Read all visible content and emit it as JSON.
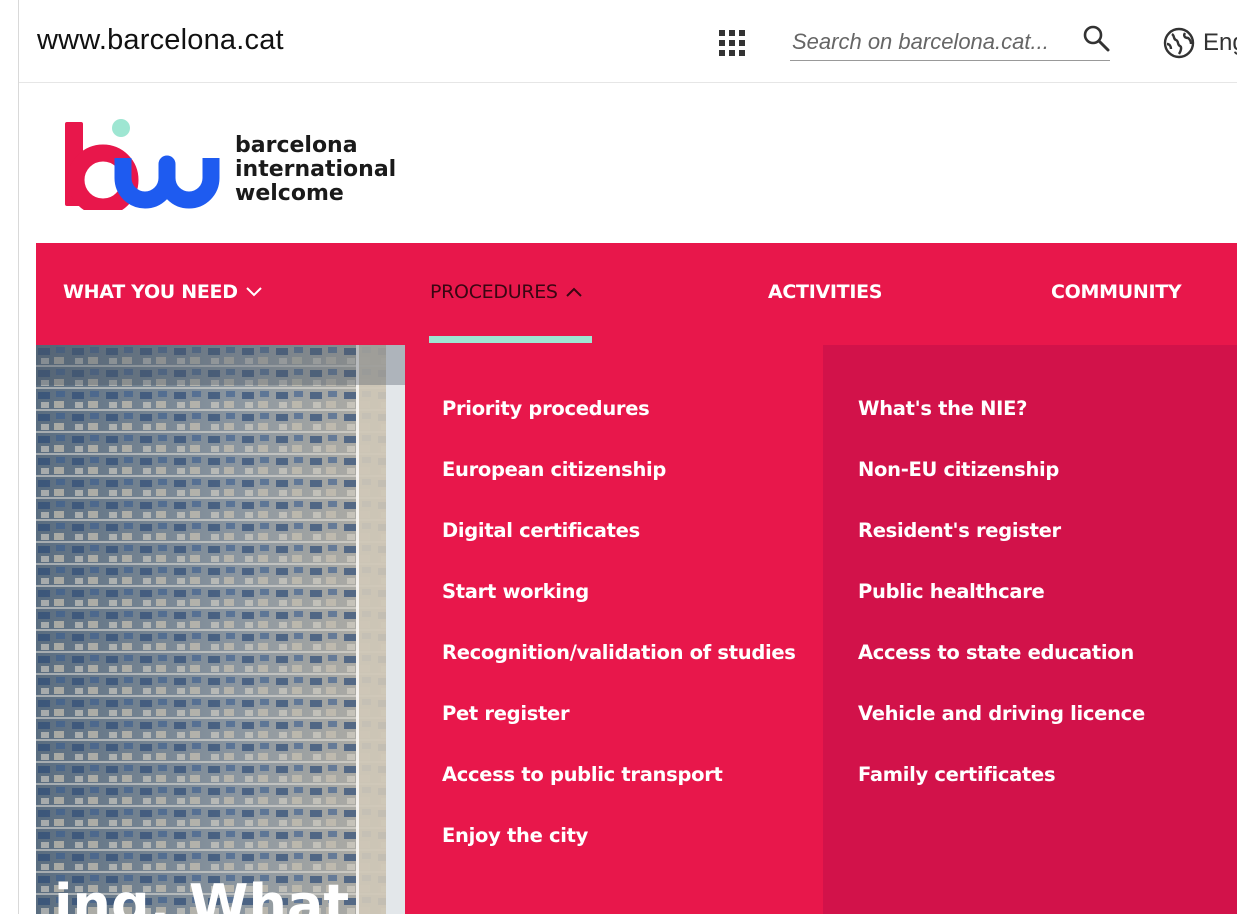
{
  "header": {
    "site_url": "www.barcelona.cat",
    "apps_icon": "grid-apps-icon",
    "search_placeholder": "Search on barcelona.cat...",
    "search_icon": "search-icon",
    "language_label": "Eng",
    "language_icon": "globe-icon"
  },
  "logo": {
    "lines": [
      "barcelona",
      "international",
      "welcome"
    ],
    "colors": {
      "red": "#e8174b",
      "blue": "#1e5bf0",
      "mint": "#9ee6d2"
    }
  },
  "nav": {
    "items": [
      {
        "label": "WHAT YOU NEED",
        "has_chevron": "down"
      },
      {
        "label": "PROCEDURES",
        "has_chevron": "up",
        "active": true
      },
      {
        "label": "ACTIVITIES"
      },
      {
        "label": "COMMUNITY"
      }
    ],
    "accent": "#9ee6d2",
    "background": "#e8174b"
  },
  "dropdown": {
    "left_column": [
      "Priority procedures",
      "European citizenship",
      "Digital certificates",
      "Start working",
      "Recognition/validation of studies",
      "Pet register",
      "Access to public transport",
      "Enjoy the city"
    ],
    "right_column": [
      "What's the NIE?",
      "Non-EU citizenship",
      "Resident's register",
      "Public healthcare",
      "Access to state education",
      "Vehicle and driving licence",
      "Family certificates"
    ]
  },
  "hero": {
    "partial_heading": "ing. What"
  }
}
